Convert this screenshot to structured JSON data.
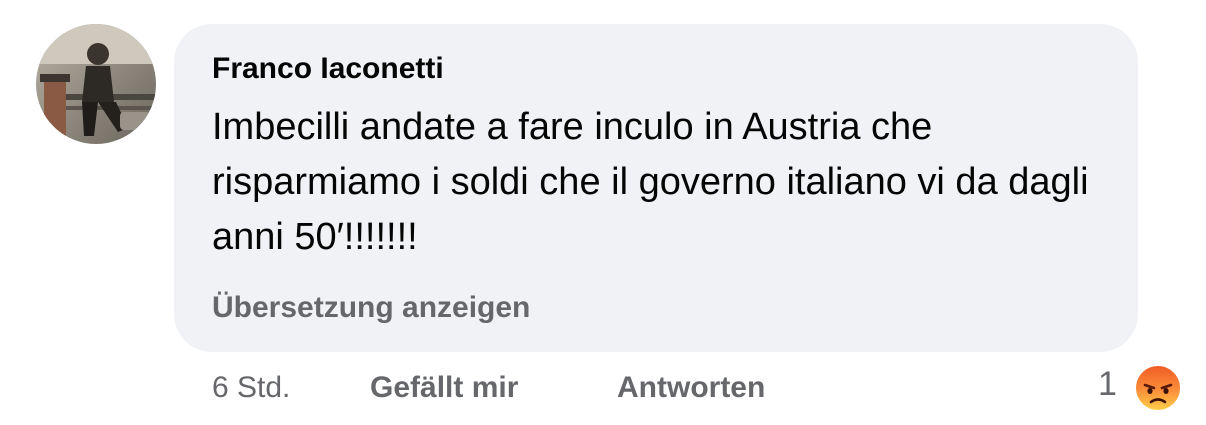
{
  "comment": {
    "author": "Franco Iaconetti",
    "text": "Imbecilli andate a fare inculo in Austria che risparmiamo i soldi che il governo italiano vi da dagli anni 50′!!!!!!!",
    "translate_link": "Übersetzung anzeigen",
    "avatar_icon": "profile-photo-icon"
  },
  "actions": {
    "time": "6 Std.",
    "like_label": "Gefällt mir",
    "reply_label": "Antworten"
  },
  "reactions": {
    "count": "1",
    "icon": "angry-reaction-icon"
  },
  "colors": {
    "bubble_bg": "#f0f2f5",
    "text": "#050505",
    "secondary": "#65676b",
    "angry_top": "#f05a24",
    "angry_bottom": "#ffd24a"
  }
}
